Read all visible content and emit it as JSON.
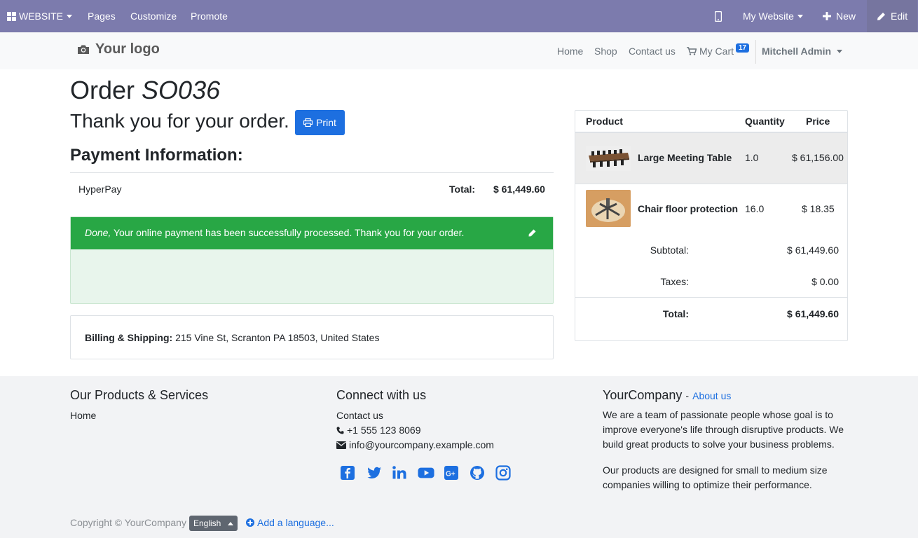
{
  "adminbar": {
    "app_label": "WEBSITE",
    "menu": [
      "Pages",
      "Customize",
      "Promote"
    ],
    "site_selector": "My Website",
    "new_label": "New",
    "edit_label": "Edit"
  },
  "header": {
    "logo_text": "Your logo",
    "nav": [
      "Home",
      "Shop",
      "Contact us"
    ],
    "cart_label": "My Cart",
    "cart_count": "17",
    "user": "Mitchell Admin"
  },
  "order": {
    "title_prefix": "Order",
    "number": "SO036",
    "thanks": "Thank you for your order.",
    "print_label": "Print",
    "payment_heading": "Payment Information:",
    "payment_method": "HyperPay",
    "total_label": "Total:",
    "total_value": "$ 61,449.60",
    "alert_status": "Done,",
    "alert_message": "Your online payment has been successfully processed. Thank you for your order.",
    "billing_label": "Billing & Shipping:",
    "billing_address": "215 Vine St, Scranton PA 18503, United States"
  },
  "summary": {
    "headers": {
      "product": "Product",
      "quantity": "Quantity",
      "price": "Price"
    },
    "lines": [
      {
        "name": "Large Meeting Table",
        "qty": "1.0",
        "price": "$ 61,156.00"
      },
      {
        "name": "Chair floor protection",
        "qty": "16.0",
        "price": "$ 18.35"
      }
    ],
    "subtotal_label": "Subtotal:",
    "subtotal_value": "$ 61,449.60",
    "taxes_label": "Taxes:",
    "taxes_value": "$ 0.00",
    "total_label": "Total:",
    "total_value": "$ 61,449.60"
  },
  "footer": {
    "col1_title": "Our Products & Services",
    "col1_link": "Home",
    "col2_title": "Connect with us",
    "col2_link": "Contact us",
    "phone": "+1 555 123 8069",
    "email": "info@yourcompany.example.com",
    "social_icons": [
      "facebook-icon",
      "twitter-icon",
      "linkedin-icon",
      "youtube-icon",
      "google-plus-icon",
      "github-icon",
      "instagram-icon"
    ],
    "col3_company": "YourCompany",
    "col3_sep": "-",
    "col3_link": "About us",
    "col3_p1": "We are a team of passionate people whose goal is to improve everyone's life through disruptive products. We build great products to solve your business problems.",
    "col3_p2": "Our products are designed for small to medium size companies willing to optimize their performance.",
    "copyright": "Copyright © YourCompany",
    "language": "English",
    "add_language": "Add a language..."
  },
  "colors": {
    "adminbar": "#7c7bad",
    "primary": "#1d6fe0",
    "success": "#28a745"
  }
}
